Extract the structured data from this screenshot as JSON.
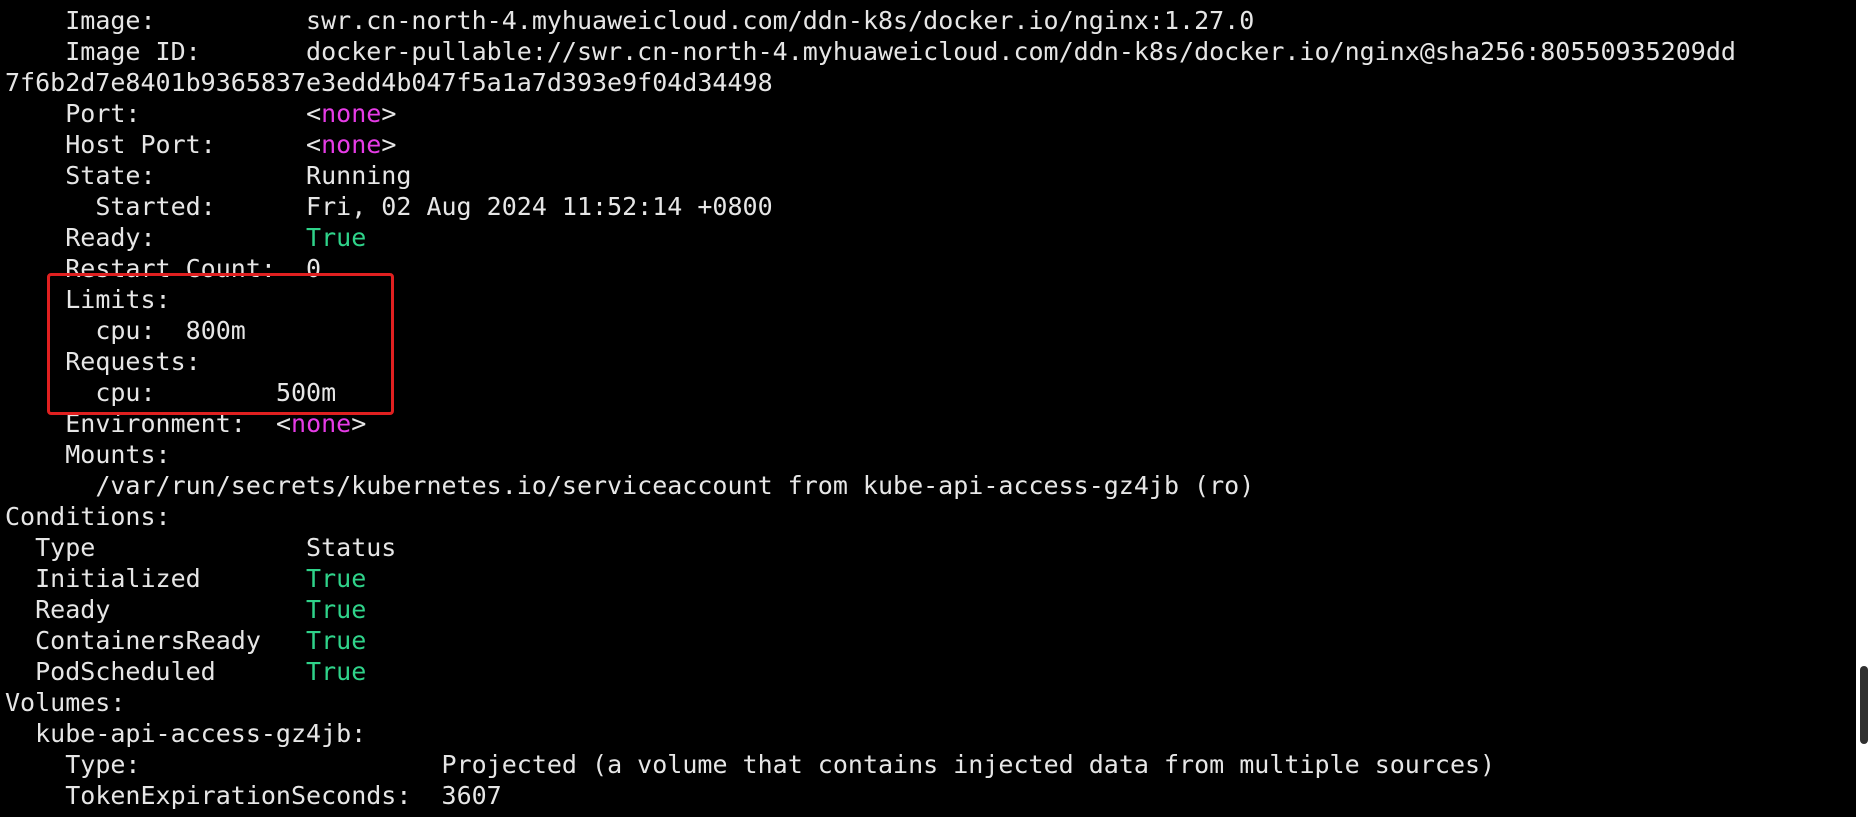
{
  "colors": {
    "background": "#000000",
    "text": "#e6e6e6",
    "none_value": "#e63be6",
    "true_value": "#2fd38a",
    "highlight_border": "#e02020"
  },
  "lines": [
    {
      "indent": "    ",
      "key": "Image:",
      "gap": "          ",
      "value": "swr.cn-north-4.myhuaweicloud.com/ddn-k8s/docker.io/nginx:1.27.0"
    },
    {
      "indent": "    ",
      "key": "Image ID:",
      "gap": "       ",
      "value": "docker-pullable://swr.cn-north-4.myhuaweicloud.com/ddn-k8s/docker.io/nginx@sha256:80550935209dd"
    },
    {
      "indent": "",
      "key": "7f6b2d7e8401b9365837e3edd4b047f5a1a7d393e9f04d34498",
      "gap": "",
      "value": ""
    },
    {
      "indent": "    ",
      "key": "Port:",
      "gap": "           ",
      "value": "<none>"
    },
    {
      "indent": "    ",
      "key": "Host Port:",
      "gap": "      ",
      "value": "<none>"
    },
    {
      "indent": "    ",
      "key": "State:",
      "gap": "          ",
      "value": "Running"
    },
    {
      "indent": "      ",
      "key": "Started:",
      "gap": "      ",
      "value": "Fri, 02 Aug 2024 11:52:14 +0800"
    },
    {
      "indent": "    ",
      "key": "Ready:",
      "gap": "          ",
      "value": "True"
    },
    {
      "indent": "    ",
      "key": "Restart Count:",
      "gap": "  ",
      "value": "0"
    },
    {
      "indent": "    ",
      "key": "Limits:",
      "gap": "",
      "value": ""
    },
    {
      "indent": "      ",
      "key": "cpu:",
      "gap": "  ",
      "value": "800m"
    },
    {
      "indent": "    ",
      "key": "Requests:",
      "gap": "",
      "value": ""
    },
    {
      "indent": "      ",
      "key": "cpu:",
      "gap": "        ",
      "value": "500m"
    },
    {
      "indent": "    ",
      "key": "Environment:",
      "gap": "  ",
      "value": "<none>"
    },
    {
      "indent": "    ",
      "key": "Mounts:",
      "gap": "",
      "value": ""
    },
    {
      "indent": "      ",
      "key": "/var/run/secrets/kubernetes.io/serviceaccount from kube-api-access-gz4jb (ro)",
      "gap": "",
      "value": ""
    },
    {
      "indent": "",
      "key": "Conditions:",
      "gap": "",
      "value": ""
    },
    {
      "indent": "  ",
      "key": "Type",
      "gap": "              ",
      "value": "Status"
    },
    {
      "indent": "  ",
      "key": "Initialized",
      "gap": "       ",
      "value": "True"
    },
    {
      "indent": "  ",
      "key": "Ready",
      "gap": "             ",
      "value": "True"
    },
    {
      "indent": "  ",
      "key": "ContainersReady",
      "gap": "   ",
      "value": "True"
    },
    {
      "indent": "  ",
      "key": "PodScheduled",
      "gap": "      ",
      "value": "True"
    },
    {
      "indent": "",
      "key": "Volumes:",
      "gap": "",
      "value": ""
    },
    {
      "indent": "  ",
      "key": "kube-api-access-gz4jb:",
      "gap": "",
      "value": ""
    },
    {
      "indent": "    ",
      "key": "Type:",
      "gap": "                    ",
      "value": "Projected (a volume that contains injected data from multiple sources)"
    },
    {
      "indent": "    ",
      "key": "TokenExpirationSeconds:",
      "gap": "  ",
      "value": "3607"
    }
  ]
}
